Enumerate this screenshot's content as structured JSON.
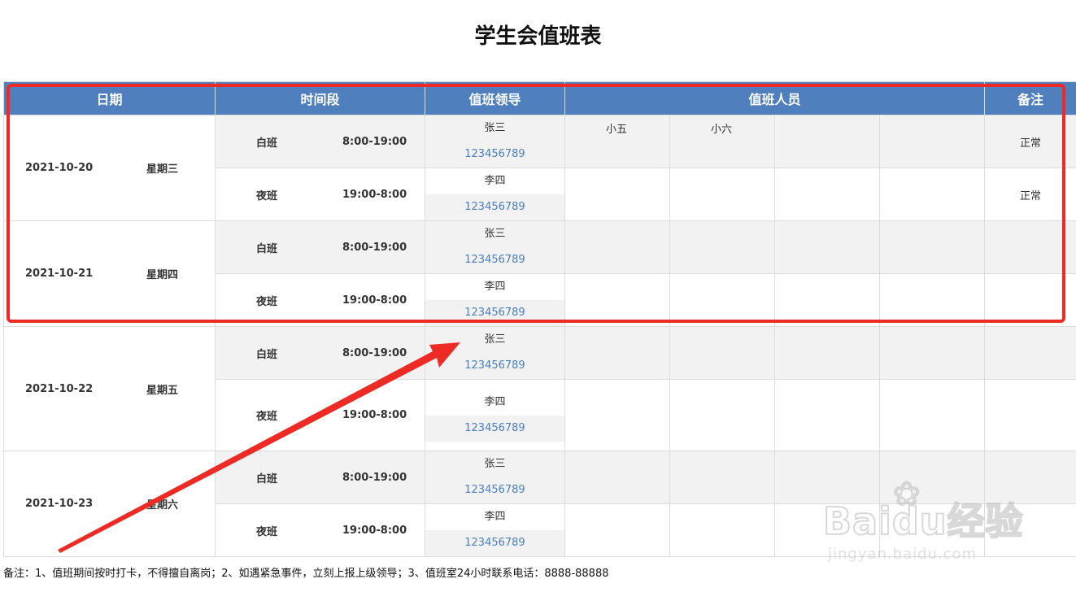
{
  "title": "学生会值班表",
  "headers": {
    "date": "日期",
    "time": "时间段",
    "leader": "值班领导",
    "staff": "值班人员",
    "note": "备注"
  },
  "days": [
    {
      "date": "2021-10-20",
      "weekday": "星期三",
      "shifts": [
        {
          "name": "白班",
          "time": "8:00-19:00",
          "leader": "张三",
          "phone": "123456789",
          "staff": [
            "小五",
            "小六",
            "",
            ""
          ],
          "note": "正常"
        },
        {
          "name": "夜班",
          "time": "19:00-8:00",
          "leader": "李四",
          "phone": "123456789",
          "staff": [
            "",
            "",
            "",
            ""
          ],
          "note": "正常"
        }
      ]
    },
    {
      "date": "2021-10-21",
      "weekday": "星期四",
      "shifts": [
        {
          "name": "白班",
          "time": "8:00-19:00",
          "leader": "张三",
          "phone": "123456789",
          "staff": [
            "",
            "",
            "",
            ""
          ],
          "note": ""
        },
        {
          "name": "夜班",
          "time": "19:00-8:00",
          "leader": "李四",
          "phone": "123456789",
          "staff": [
            "",
            "",
            "",
            ""
          ],
          "note": ""
        }
      ]
    },
    {
      "date": "2021-10-22",
      "weekday": "星期五",
      "shifts": [
        {
          "name": "白班",
          "time": "8:00-19:00",
          "leader": "张三",
          "phone": "123456789",
          "staff": [
            "",
            "",
            "",
            ""
          ],
          "note": ""
        },
        {
          "name": "夜班",
          "time": "19:00-8:00",
          "leader": "李四",
          "phone": "123456789",
          "staff": [
            "",
            "",
            "",
            ""
          ],
          "note": ""
        }
      ]
    },
    {
      "date": "2021-10-23",
      "weekday": "星期六",
      "shifts": [
        {
          "name": "白班",
          "time": "8:00-19:00",
          "leader": "张三",
          "phone": "123456789",
          "staff": [
            "",
            "",
            "",
            ""
          ],
          "note": ""
        },
        {
          "name": "夜班",
          "time": "19:00-8:00",
          "leader": "李四",
          "phone": "123456789",
          "staff": [
            "",
            "",
            "",
            ""
          ],
          "note": ""
        }
      ]
    }
  ],
  "footnote": "备注：1、值班期间按时打卡，不得擅自离岗；2、如遇紧急事件，立刻上报上级领导；3、值班室24小时联系电话：8888-88888",
  "watermark": {
    "main": "Baidu经验",
    "sub": "jingyan.baidu.com"
  },
  "colors": {
    "header": "#4f80bd",
    "annotation": "#ee2a24",
    "phone": "#4a7fc0",
    "stripe": "#f2f2f2"
  }
}
